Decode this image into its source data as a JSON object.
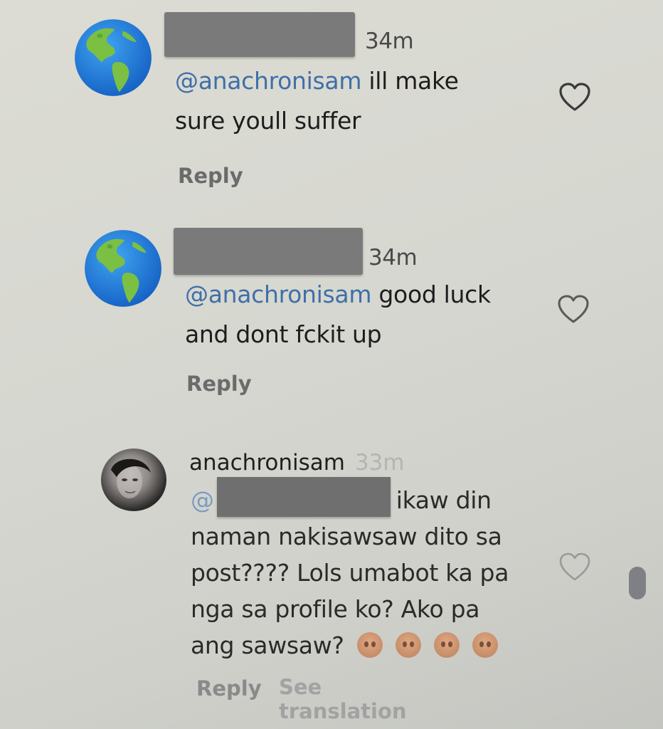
{
  "comments": [
    {
      "time": "34m",
      "mention": "@anachronisam",
      "lines": [
        "ill make",
        "sure youll suffer"
      ],
      "reply_label": "Reply",
      "avatar_icon": "globe-americas-icon",
      "username_redacted": true
    },
    {
      "time": "34m",
      "mention": "@anachronisam",
      "lines": [
        "good luck",
        "and dont fckit up"
      ],
      "reply_label": "Reply",
      "avatar_icon": "globe-americas-icon",
      "username_redacted": true
    },
    {
      "username": "anachronisam",
      "time": "33m",
      "mention_prefix": "@",
      "lines": [
        "ikaw din",
        "naman nakisawsaw dito sa",
        "post???? Lols umabot ka pa",
        "nga sa profile ko? Ako pa",
        "ang sawsaw?"
      ],
      "emojis": [
        "pouting-face-icon",
        "pouting-face-icon",
        "pouting-face-icon",
        "pouting-face-icon"
      ],
      "reply_label": "Reply",
      "see_translation_label": "See translation",
      "avatar_icon": "profile-photo"
    }
  ],
  "icons": {
    "like": "heart-outline-icon"
  },
  "colors": {
    "mention": "#3f6fa8",
    "redaction": "#7a7a7a"
  }
}
